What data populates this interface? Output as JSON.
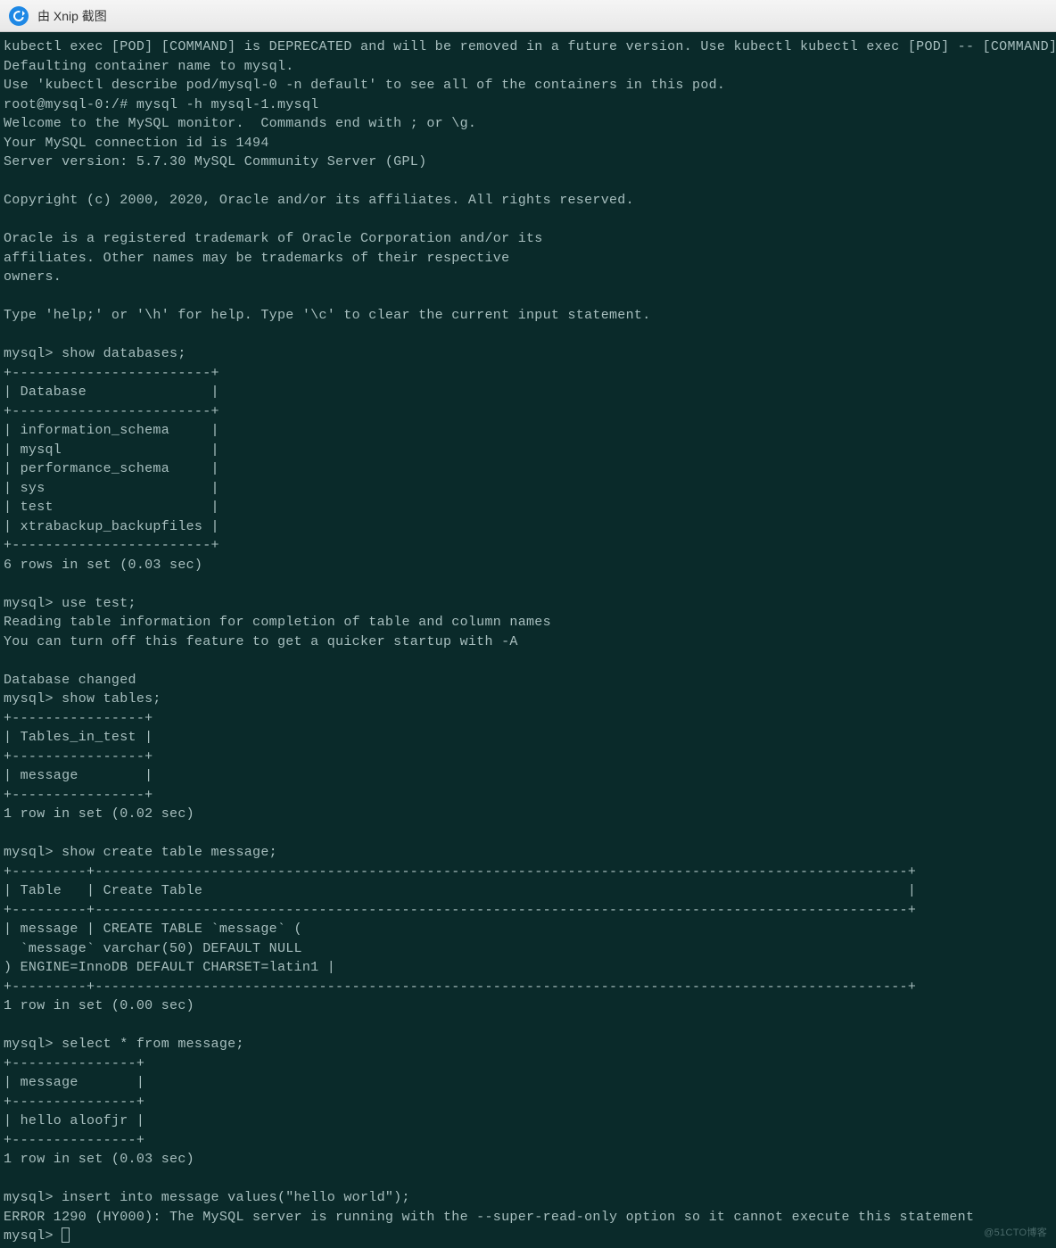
{
  "titlebar": {
    "text": "由 Xnip 截图"
  },
  "terminal": {
    "lines": [
      "kubectl exec [POD] [COMMAND] is DEPRECATED and will be removed in a future version. Use kubectl kubectl exec [POD] -- [COMMAND] instead.",
      "Defaulting container name to mysql.",
      "Use 'kubectl describe pod/mysql-0 -n default' to see all of the containers in this pod.",
      "root@mysql-0:/# mysql -h mysql-1.mysql",
      "Welcome to the MySQL monitor.  Commands end with ; or \\g.",
      "Your MySQL connection id is 1494",
      "Server version: 5.7.30 MySQL Community Server (GPL)",
      "",
      "Copyright (c) 2000, 2020, Oracle and/or its affiliates. All rights reserved.",
      "",
      "Oracle is a registered trademark of Oracle Corporation and/or its",
      "affiliates. Other names may be trademarks of their respective",
      "owners.",
      "",
      "Type 'help;' or '\\h' for help. Type '\\c' to clear the current input statement.",
      "",
      "mysql> show databases;",
      "+------------------------+",
      "| Database               |",
      "+------------------------+",
      "| information_schema     |",
      "| mysql                  |",
      "| performance_schema     |",
      "| sys                    |",
      "| test                   |",
      "| xtrabackup_backupfiles |",
      "+------------------------+",
      "6 rows in set (0.03 sec)",
      "",
      "mysql> use test;",
      "Reading table information for completion of table and column names",
      "You can turn off this feature to get a quicker startup with -A",
      "",
      "Database changed",
      "mysql> show tables;",
      "+----------------+",
      "| Tables_in_test |",
      "+----------------+",
      "| message        |",
      "+----------------+",
      "1 row in set (0.02 sec)",
      "",
      "mysql> show create table message;",
      "+---------+--------------------------------------------------------------------------------------------------+",
      "| Table   | Create Table                                                                                     |",
      "+---------+--------------------------------------------------------------------------------------------------+",
      "| message | CREATE TABLE `message` (",
      "  `message` varchar(50) DEFAULT NULL",
      ") ENGINE=InnoDB DEFAULT CHARSET=latin1 |",
      "+---------+--------------------------------------------------------------------------------------------------+",
      "1 row in set (0.00 sec)",
      "",
      "mysql> select * from message;",
      "+---------------+",
      "| message       |",
      "+---------------+",
      "| hello aloofjr |",
      "+---------------+",
      "1 row in set (0.03 sec)",
      "",
      "mysql> insert into message values(\"hello world\");",
      "ERROR 1290 (HY000): The MySQL server is running with the --super-read-only option so it cannot execute this statement"
    ],
    "prompt": "mysql> ",
    "watermark": "@51CTO博客"
  }
}
